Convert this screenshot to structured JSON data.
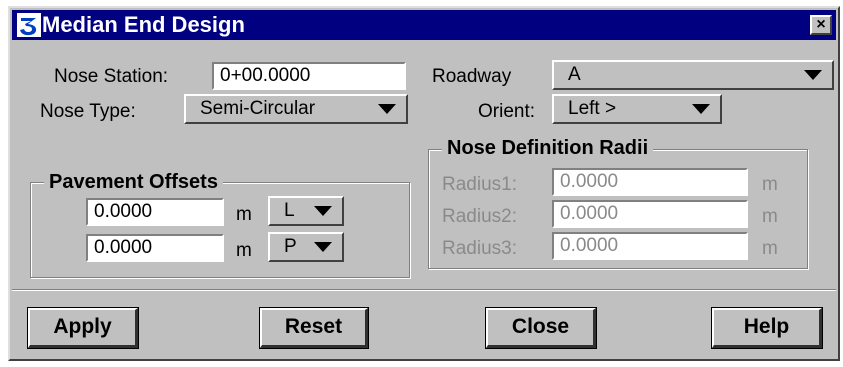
{
  "window": {
    "title": "Median End Design",
    "close_glyph": "×",
    "app_icon": "three-icon"
  },
  "nose_station": {
    "label": "Nose Station:",
    "value": "0+00.0000"
  },
  "nose_type": {
    "label": "Nose Type:",
    "value": "Semi-Circular"
  },
  "roadway": {
    "label": "Roadway",
    "value": "A"
  },
  "orient": {
    "label": "Orient:",
    "value": "Left >"
  },
  "pavement_offsets": {
    "title": "Pavement Offsets",
    "rows": [
      {
        "value": "0.0000",
        "unit": "m",
        "side": "L"
      },
      {
        "value": "0.0000",
        "unit": "m",
        "side": "P"
      }
    ]
  },
  "nose_radii": {
    "title": "Nose Definition Radii",
    "rows": [
      {
        "label": "Radius1:",
        "value": "0.0000",
        "unit": "m"
      },
      {
        "label": "Radius2:",
        "value": "0.0000",
        "unit": "m"
      },
      {
        "label": "Radius3:",
        "value": "0.0000",
        "unit": "m"
      }
    ]
  },
  "buttons": {
    "apply": "Apply",
    "reset": "Reset",
    "close": "Close",
    "help": "Help"
  },
  "colors": {
    "titlebar": "#000080",
    "face": "#c0c0c0",
    "disabled_text": "#8a8a8a"
  }
}
